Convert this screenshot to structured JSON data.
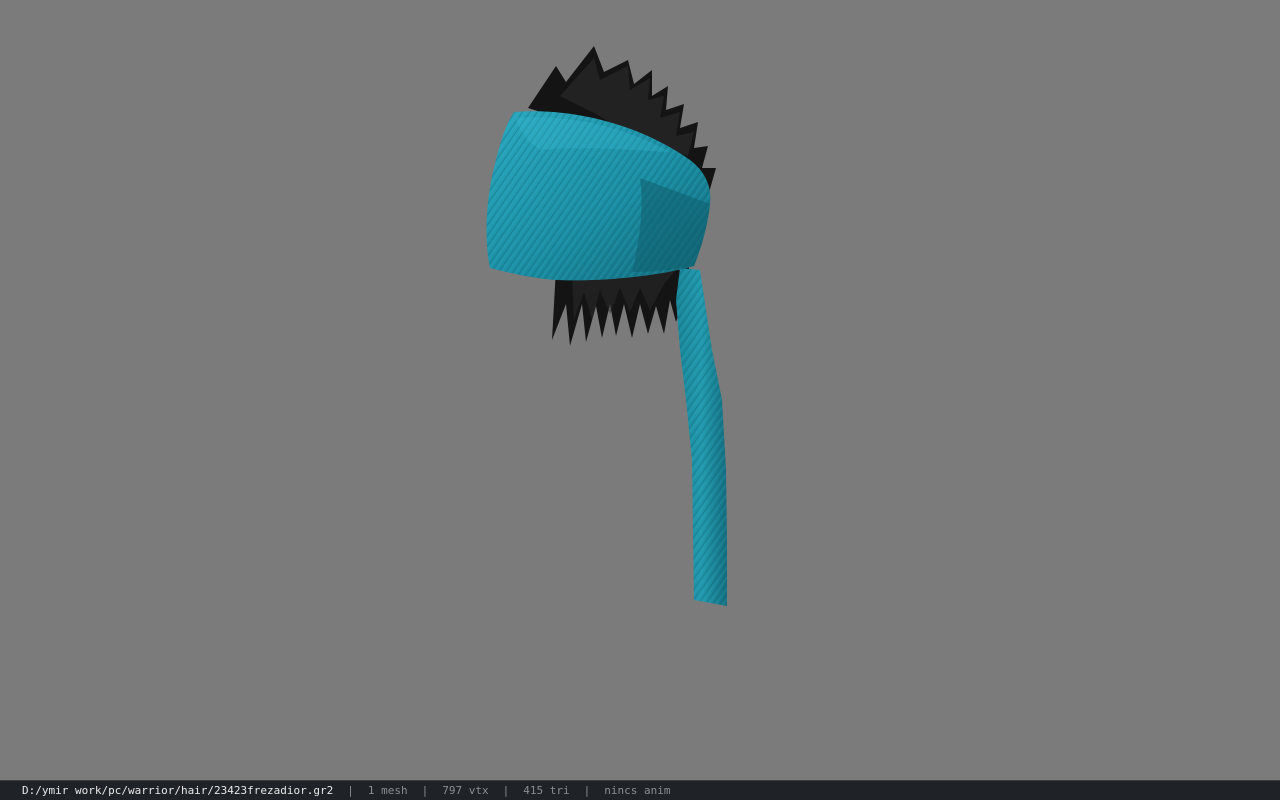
{
  "viewport": {
    "background_color": "#7b7b7b",
    "model_colors": {
      "bandana": "#1b8ea3",
      "bandana_shade": "#13697a",
      "bandana_light": "#2aa8bf",
      "hair": "#141414",
      "hair_light": "#2b2b2b"
    }
  },
  "statusbar": {
    "file_path": "D:/ymir work/pc/warrior/hair/23423frezadior.gr2",
    "separator": "|",
    "mesh_count": "1 mesh",
    "vertex_count": "797 vtx",
    "triangle_count": "415 tri",
    "anim_status": "nincs anim"
  }
}
